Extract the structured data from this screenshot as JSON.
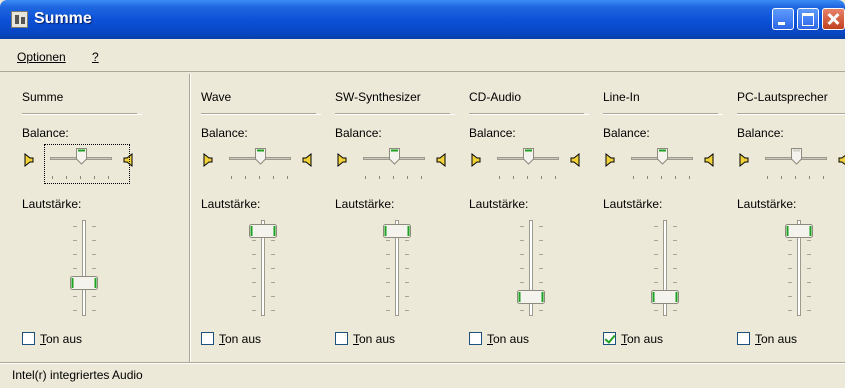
{
  "window": {
    "title": "Summe"
  },
  "menu": {
    "options": "Optionen",
    "help": "?"
  },
  "channels": [
    {
      "name": "Summe",
      "balance_label": "Balance:",
      "volume_label": "Lautstärke:",
      "mute_label": "Ton aus",
      "muted": false,
      "balance": 0.5,
      "volume": 0.32,
      "disabled": false
    },
    {
      "name": "Wave",
      "balance_label": "Balance:",
      "volume_label": "Lautstärke:",
      "mute_label": "Ton aus",
      "muted": false,
      "balance": 0.5,
      "volume": 0.95,
      "disabled": false
    },
    {
      "name": "SW-Synthesizer",
      "balance_label": "Balance:",
      "volume_label": "Lautstärke:",
      "mute_label": "Ton aus",
      "muted": false,
      "balance": 0.5,
      "volume": 0.95,
      "disabled": false
    },
    {
      "name": "CD-Audio",
      "balance_label": "Balance:",
      "volume_label": "Lautstärke:",
      "mute_label": "Ton aus",
      "muted": false,
      "balance": 0.5,
      "volume": 0.15,
      "disabled": false
    },
    {
      "name": "Line-In",
      "balance_label": "Balance:",
      "volume_label": "Lautstärke:",
      "mute_label": "Ton aus",
      "muted": true,
      "balance": 0.5,
      "volume": 0.15,
      "disabled": false
    },
    {
      "name": "PC-Lautsprecher",
      "balance_label": "Balance:",
      "volume_label": "Lautstärke:",
      "mute_label": "Ton aus",
      "muted": false,
      "balance": 0.5,
      "volume": 0.95,
      "disabled": true
    }
  ],
  "status": {
    "text": "Intel(r) integriertes Audio"
  },
  "colors": {
    "titlebar": "#0a50d6",
    "face": "#ece9d8",
    "thumb_green": "#21a121"
  }
}
